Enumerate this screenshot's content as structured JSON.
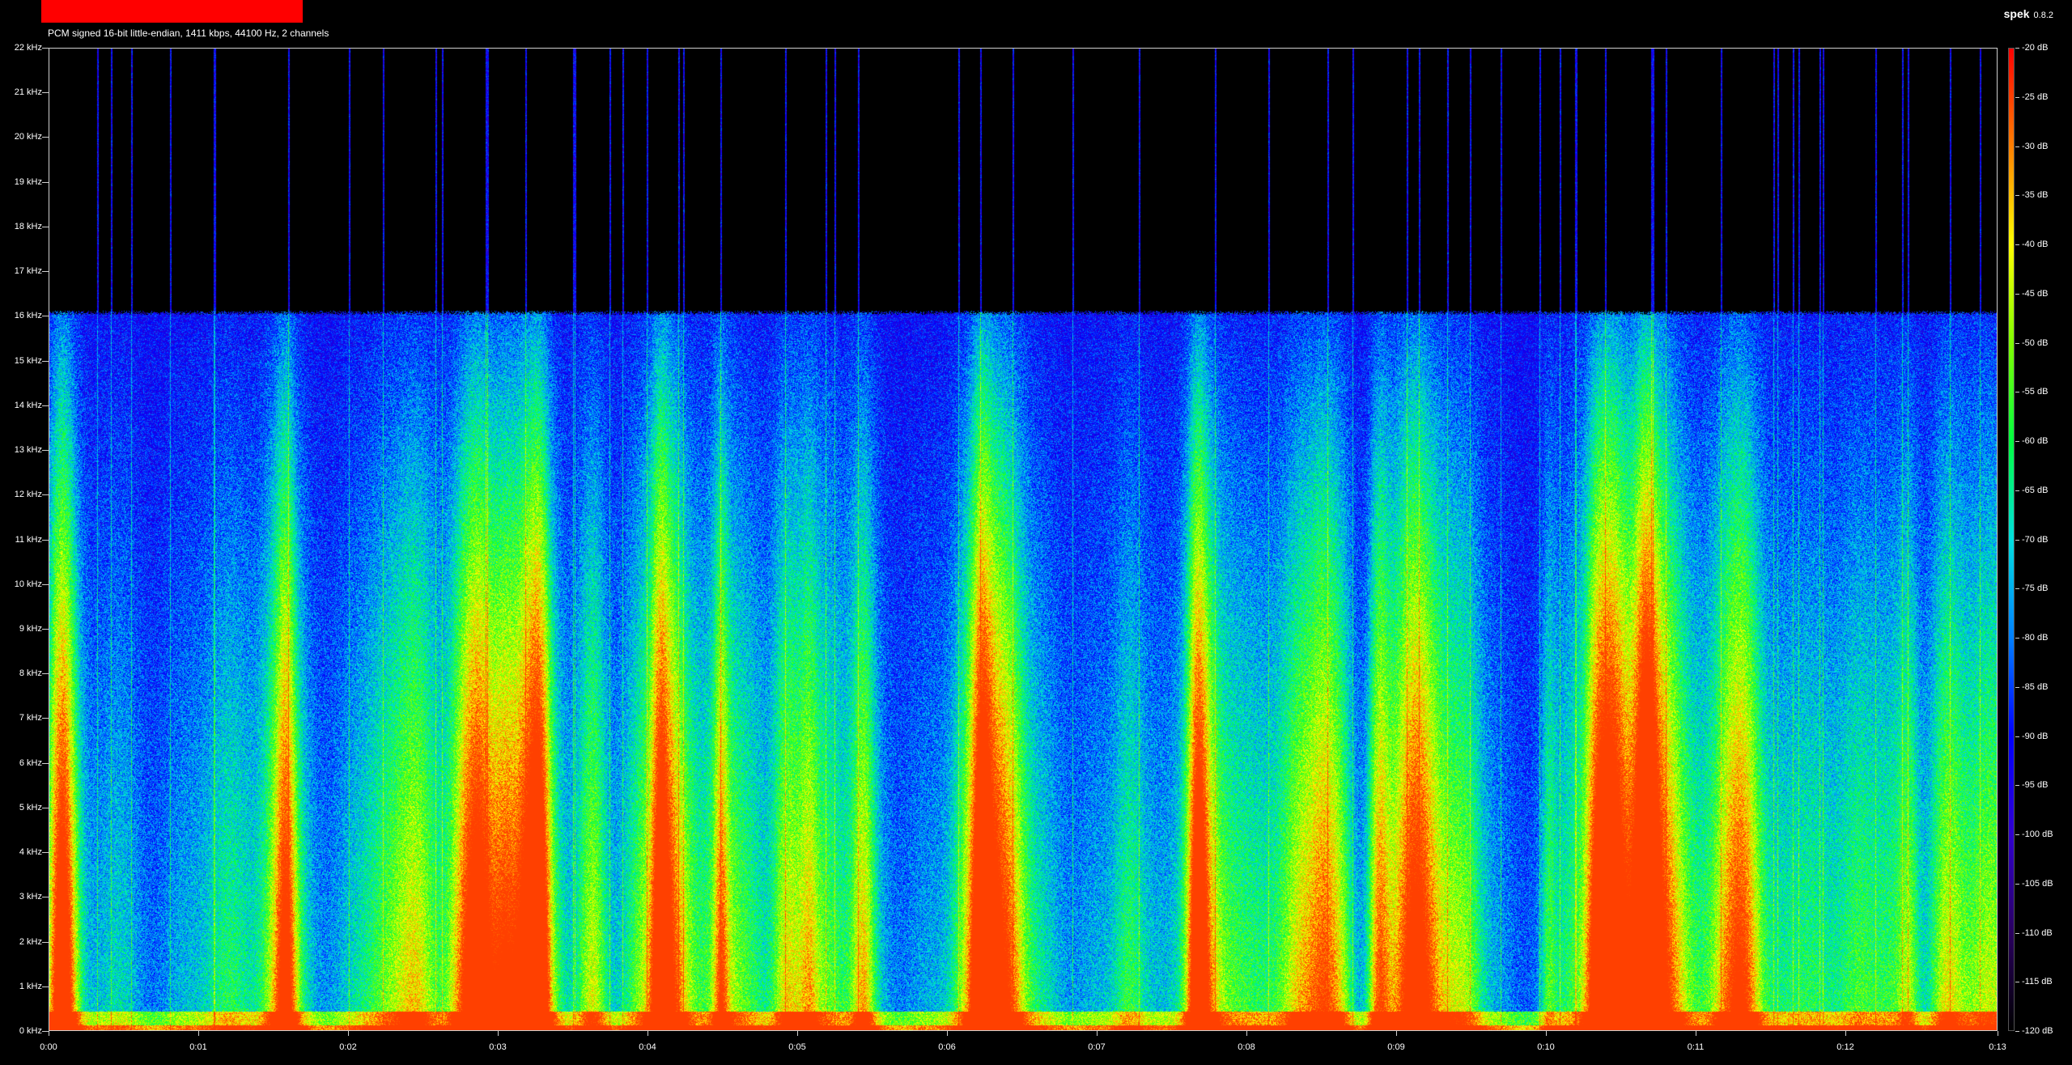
{
  "header": {
    "file_info": "PCM signed 16-bit little-endian, 1411 kbps, 44100 Hz, 2 channels",
    "title_bar_color": "#ff0000"
  },
  "brand": {
    "name": "spek",
    "version": "0.8.2"
  },
  "spectrogram": {
    "duration_label": "0:13",
    "y_labels": [
      "22 kHz",
      "21 kHz",
      "20 kHz",
      "19 kHz",
      "18 kHz",
      "17 kHz",
      "16 kHz",
      "15 kHz",
      "14 kHz",
      "13 kHz",
      "12 kHz",
      "11 kHz",
      "10 kHz",
      "9 kHz",
      "8 kHz",
      "7 kHz",
      "6 kHz",
      "5 kHz",
      "4 kHz",
      "3 kHz",
      "2 kHz",
      "1 kHz",
      "0 kHz"
    ],
    "x_labels": [
      "0:00",
      "0:01",
      "0:02",
      "0:03",
      "0:04",
      "0:05",
      "0:06",
      "0:07",
      "0:08",
      "0:09",
      "0:10",
      "0:11",
      "0:12",
      "0:13"
    ],
    "cutoff_khz": 16,
    "palette": [
      "#000000",
      "#2a0060",
      "#3000d0",
      "#0000ff",
      "#0080ff",
      "#00e0e0",
      "#00ff40",
      "#80ff00",
      "#ffff00",
      "#ff8000",
      "#ff0000"
    ]
  },
  "colorbar": {
    "labels": [
      "-20 dB",
      "-25 dB",
      "-30 dB",
      "-35 dB",
      "-40 dB",
      "-45 dB",
      "-50 dB",
      "-55 dB",
      "-60 dB",
      "-65 dB",
      "-70 dB",
      "-75 dB",
      "-80 dB",
      "-85 dB",
      "-90 dB",
      "-95 dB",
      "-100 dB",
      "-105 dB",
      "-110 dB",
      "-115 dB",
      "-120 dB"
    ]
  }
}
